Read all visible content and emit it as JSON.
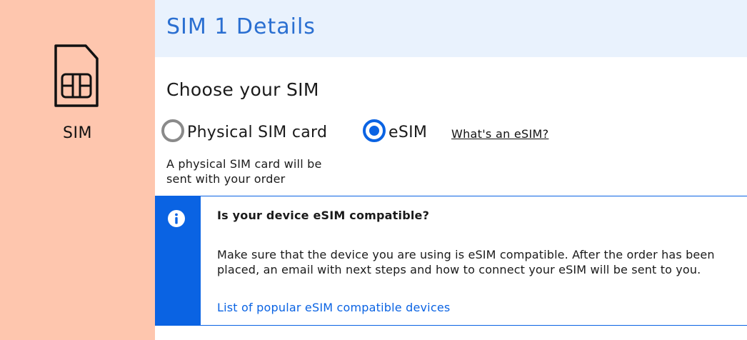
{
  "sidebar": {
    "icon": "sim-card-icon",
    "label": "SIM"
  },
  "header": {
    "title": "SIM 1 Details"
  },
  "sim_choice": {
    "title": "Choose your SIM",
    "options": [
      {
        "label": "Physical SIM card",
        "selected": false
      },
      {
        "label": "eSIM",
        "selected": true
      }
    ],
    "esim_help_link": "What's an eSIM?",
    "physical_note": "A physical SIM card will be sent with your order"
  },
  "info_box": {
    "icon": "info-icon",
    "heading": "Is your device eSIM compatible?",
    "body": "Make sure that the device you are using is eSIM compatible. After the order has been placed, an email with next steps and how to connect your eSIM will be sent to you.",
    "link": "List of popular eSIM compatible devices"
  },
  "colors": {
    "sidebar_bg": "#fec6ae",
    "header_bg": "#e9f2fd",
    "accent_blue": "#0a63e3",
    "title_blue": "#2a6fd1"
  }
}
